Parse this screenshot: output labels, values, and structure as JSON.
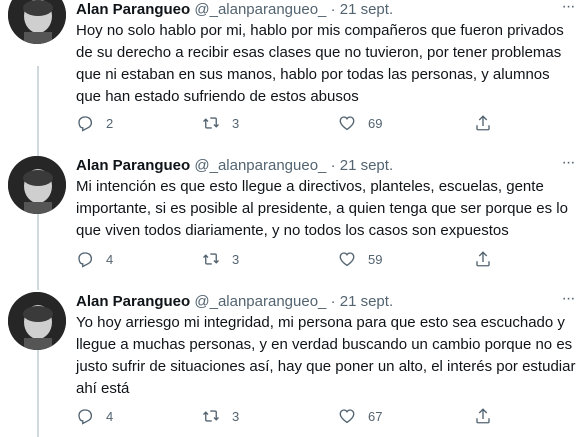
{
  "tweets": [
    {
      "name": "Alan Parangueo",
      "handle": "@_alanparangueo_",
      "separator": "·",
      "time": "21 sept.",
      "more": "···",
      "text": "Hoy no solo hablo por mi, hablo por mis compañeros que fueron privados de su derecho a recibir esas clases que no tuvieron, por tener problemas que ni estaban en sus manos, hablo por todas las personas, y alumnos que han estado sufriendo de estos abusos",
      "replies": "2",
      "retweets": "3",
      "likes": "69"
    },
    {
      "name": "Alan Parangueo",
      "handle": "@_alanparangueo_",
      "separator": "·",
      "time": "21 sept.",
      "more": "···",
      "text": "Mi intención es que esto llegue a directivos, planteles, escuelas, gente importante, si es posible al presidente, a quien tenga que ser porque es lo que viven todos diariamente, y no todos los casos son expuestos",
      "replies": "4",
      "retweets": "3",
      "likes": "59"
    },
    {
      "name": "Alan Parangueo",
      "handle": "@_alanparangueo_",
      "separator": "·",
      "time": "21 sept.",
      "more": "···",
      "text": "Yo hoy arriesgo mi integridad, mi persona para que esto sea escuchado y llegue a muchas personas, y en verdad buscando un cambio porque no es justo sufrir de situaciones así, hay que poner un alto, el interés por estudiar ahí está",
      "replies": "4",
      "retweets": "3",
      "likes": "67"
    }
  ],
  "icons": {
    "reply": "reply-icon",
    "retweet": "retweet-icon",
    "like": "heart-icon",
    "share": "share-icon"
  },
  "colors": {
    "secondary_text": "#536471",
    "thread_line": "#cfd9de"
  }
}
